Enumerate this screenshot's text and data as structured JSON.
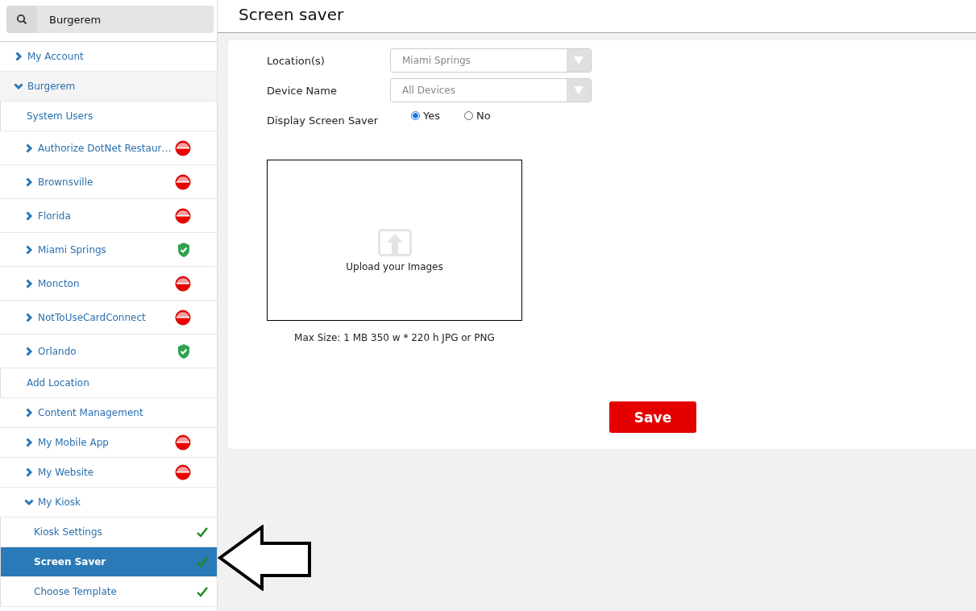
{
  "search": {
    "value": "Burgerem"
  },
  "sidebar": {
    "items": [
      {
        "label": "My Account",
        "kind": "section",
        "expanded": false
      },
      {
        "label": "Burgerem",
        "kind": "section",
        "expanded": true,
        "children": [
          {
            "label": "System Users",
            "kind": "link"
          },
          {
            "label": "Authorize DotNet Restaur…",
            "kind": "location",
            "expanded": false,
            "complete": false
          },
          {
            "label": "Brownsville",
            "kind": "location",
            "expanded": false,
            "complete": false
          },
          {
            "label": "Florida",
            "kind": "location",
            "expanded": false,
            "complete": false
          },
          {
            "label": "Miami Springs",
            "kind": "location",
            "expanded": false,
            "complete": true
          },
          {
            "label": "Moncton",
            "kind": "location",
            "expanded": false,
            "complete": false
          },
          {
            "label": "NotToUseCardConnect",
            "kind": "location",
            "expanded": false,
            "complete": false
          },
          {
            "label": "Orlando",
            "kind": "location",
            "expanded": false,
            "complete": true
          },
          {
            "label": "Add Location",
            "kind": "link"
          },
          {
            "label": "Content Management",
            "kind": "section",
            "expanded": false
          },
          {
            "label": "My Mobile App",
            "kind": "section",
            "expanded": false,
            "complete": false
          },
          {
            "label": "My Website",
            "kind": "section",
            "expanded": false,
            "complete": false
          },
          {
            "label": "My Kiosk",
            "kind": "section",
            "expanded": true,
            "children": [
              {
                "label": "Kiosk Settings",
                "kind": "page",
                "complete": true,
                "selected": false
              },
              {
                "label": "Screen Saver",
                "kind": "page",
                "complete": true,
                "selected": true
              },
              {
                "label": "Choose Template",
                "kind": "page",
                "complete": true,
                "selected": false
              }
            ]
          }
        ]
      }
    ]
  },
  "page": {
    "title": "Screen saver",
    "fields": [
      {
        "label": "Location(s)",
        "kind": "select",
        "value": "Miami Springs"
      },
      {
        "label": "Device Name",
        "kind": "select",
        "value": "All Devices"
      },
      {
        "label": "Display Screen Saver",
        "kind": "radio",
        "options": [
          {
            "label": "Yes",
            "selected": true
          },
          {
            "label": "No",
            "selected": false
          }
        ]
      }
    ],
    "upload": {
      "label": "Upload your Images",
      "note": "Max Size: 1 MB 350 w * 220 h JPG or PNG"
    },
    "save_button": "Save"
  }
}
